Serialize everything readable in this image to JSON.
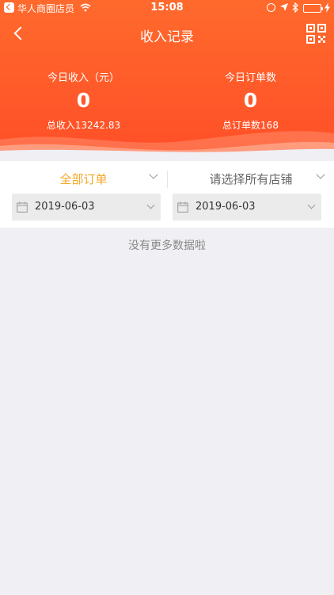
{
  "status_bar": {
    "carrier": "华人商圈店员",
    "time": "15:08"
  },
  "nav": {
    "title": "收入记录",
    "back_icon": "chevron-left-icon",
    "scan_icon": "qr-code-icon"
  },
  "stats": {
    "income": {
      "label": "今日收入（元）",
      "value": "0",
      "total": "总收入13242.83"
    },
    "orders": {
      "label": "今日订单数",
      "value": "0",
      "total": "总订单数168"
    }
  },
  "filters": {
    "order_type": "全部订单",
    "store": "请选择所有店铺",
    "start_date": "2019-06-03",
    "end_date": "2019-06-03"
  },
  "empty_text": "没有更多数据啦",
  "colors": {
    "header": "#ff5a2a",
    "accent": "#f5a623",
    "background": "#efeff4"
  }
}
